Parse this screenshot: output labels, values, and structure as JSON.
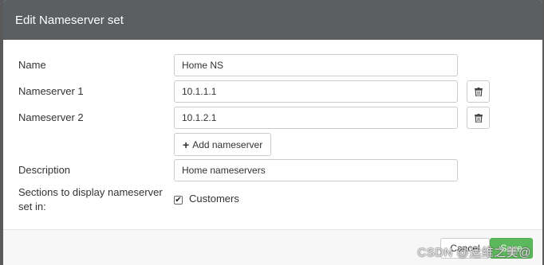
{
  "modal": {
    "title": "Edit Nameserver set",
    "fields": {
      "name_label": "Name",
      "name_value": "Home NS",
      "ns1_label": "Nameserver 1",
      "ns1_value": "10.1.1.1",
      "ns2_label": "Nameserver 2",
      "ns2_value": "10.1.2.1",
      "add_label": "Add nameserver",
      "description_label": "Description",
      "description_value": "Home nameservers",
      "sections_label_line1": "Sections to display nameserver",
      "sections_label_line2": "set in:",
      "customers_label": "Customers",
      "customers_checked": true
    },
    "footer": {
      "cancel_label": "Cancel",
      "save_label": "Save"
    }
  },
  "watermark": "CSDN @运维之美@",
  "icons": {
    "trash": "trash-icon",
    "plus": "plus-icon",
    "check": "check-icon"
  },
  "colors": {
    "header_bg": "#5b5f62",
    "save_bg": "#5cb85c"
  }
}
